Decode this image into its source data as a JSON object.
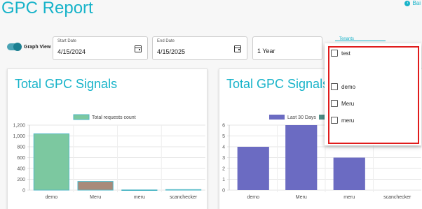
{
  "header": {
    "title": "GPC Report",
    "back_label": "Bai"
  },
  "filters": {
    "graph_view_label": "Graph View",
    "start_date": {
      "label": "Start Date",
      "value": "4/15/2024"
    },
    "end_date": {
      "label": "End Date",
      "value": "4/15/2025"
    },
    "range": {
      "value": "1 Year"
    },
    "tenants_label": "Tenants"
  },
  "tenants_dropdown": {
    "options": [
      "test",
      "demo",
      "Meru",
      "meru"
    ],
    "highlight_color": "#e01c1c"
  },
  "colors": {
    "accent": "#17b3c9",
    "bar_green": "#7cc8a0",
    "bar_brown": "#a88a7a",
    "bar_purple": "#6b6bc2"
  },
  "chart_data": [
    {
      "type": "bar",
      "title": "Total GPC Signals",
      "categories": [
        "demo",
        "Meru",
        "meru",
        "scanchecker"
      ],
      "series": [
        {
          "name": "Total requests count",
          "values": [
            1040,
            160,
            4,
            10
          ]
        }
      ],
      "ylim": [
        0,
        1200
      ],
      "yticks": [
        "0",
        "200",
        "400",
        "600",
        "800",
        "1,000",
        "1,200"
      ],
      "legend": "top",
      "grid": true
    },
    {
      "type": "bar",
      "title": "Total GPC Signals",
      "categories": [
        "demo",
        "Meru",
        "meru",
        "scanchecker"
      ],
      "series": [
        {
          "name": "Last 30 Days",
          "values": [
            4,
            6,
            3,
            0
          ]
        }
      ],
      "ylim": [
        0,
        6
      ],
      "yticks": [
        "0",
        "1",
        "2",
        "3",
        "4",
        "5",
        "6"
      ],
      "legend": "top",
      "grid": true
    }
  ]
}
